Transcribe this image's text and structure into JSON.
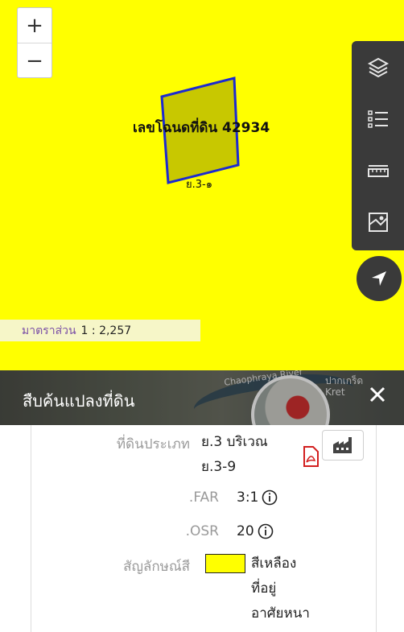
{
  "map": {
    "zoom": {
      "in": "+",
      "out": "−"
    },
    "parcel": {
      "deed_label": "เลขโฉนดที่ดิน 42934",
      "zone_label": "ย.3-๑"
    },
    "scale": {
      "label": "มาตราส่วน",
      "value": "1 : 2,257"
    },
    "parcel_fill": "#c8c800",
    "parcel_stroke": "#1c2ad0",
    "background": "#ffff00"
  },
  "toolbar": {
    "tools": [
      "layers-icon",
      "legend-list-icon",
      "measure-ruler-icon",
      "basemap-icon"
    ],
    "locate": "locate-arrow-icon"
  },
  "panel": {
    "title": "สืบค้นแปลงที่ดิน",
    "header_places": {
      "river": "Chaophraya River",
      "place": "ปากเกร็ด",
      "place_en": "Kret"
    },
    "land_type": {
      "label": "ที่ดินประเภท",
      "value_line1": "ย.3 บริเวณ",
      "value_line2": "ย.3-9"
    },
    "far": {
      "label": ".FAR",
      "value": "3:1"
    },
    "osr": {
      "label": ".OSR",
      "value": "20"
    },
    "color": {
      "label": "สัญลักษณ์สี",
      "swatch": "#ffff00",
      "line1": "สีเหลือง",
      "line2": "ที่อยู่",
      "line3": "อาศัยหนา"
    },
    "pdf_icon_color": "#d21f1f"
  }
}
